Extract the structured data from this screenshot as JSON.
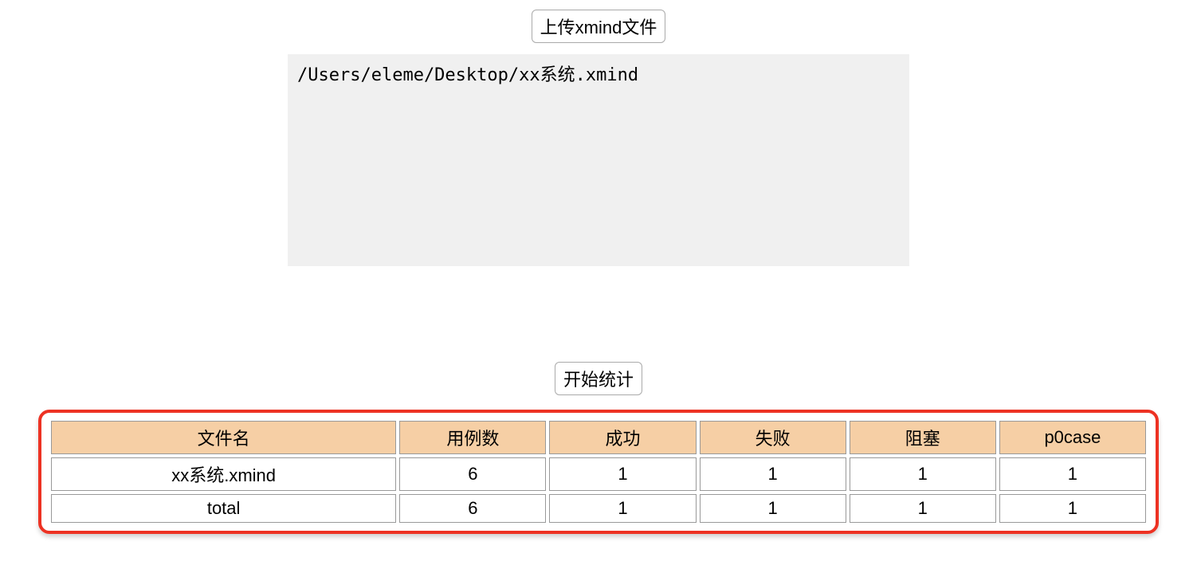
{
  "upload": {
    "button_label": "上传xmind文件",
    "file_path": "/Users/eleme/Desktop/xx系统.xmind"
  },
  "stats": {
    "button_label": "开始统计"
  },
  "table": {
    "headers": {
      "filename": "文件名",
      "case_count": "用例数",
      "success": "成功",
      "fail": "失败",
      "blocked": "阻塞",
      "p0case": "p0case"
    },
    "rows": [
      {
        "filename": "xx系统.xmind",
        "case_count": "6",
        "success": "1",
        "fail": "1",
        "blocked": "1",
        "p0case": "1"
      },
      {
        "filename": "total",
        "case_count": "6",
        "success": "1",
        "fail": "1",
        "blocked": "1",
        "p0case": "1"
      }
    ]
  }
}
